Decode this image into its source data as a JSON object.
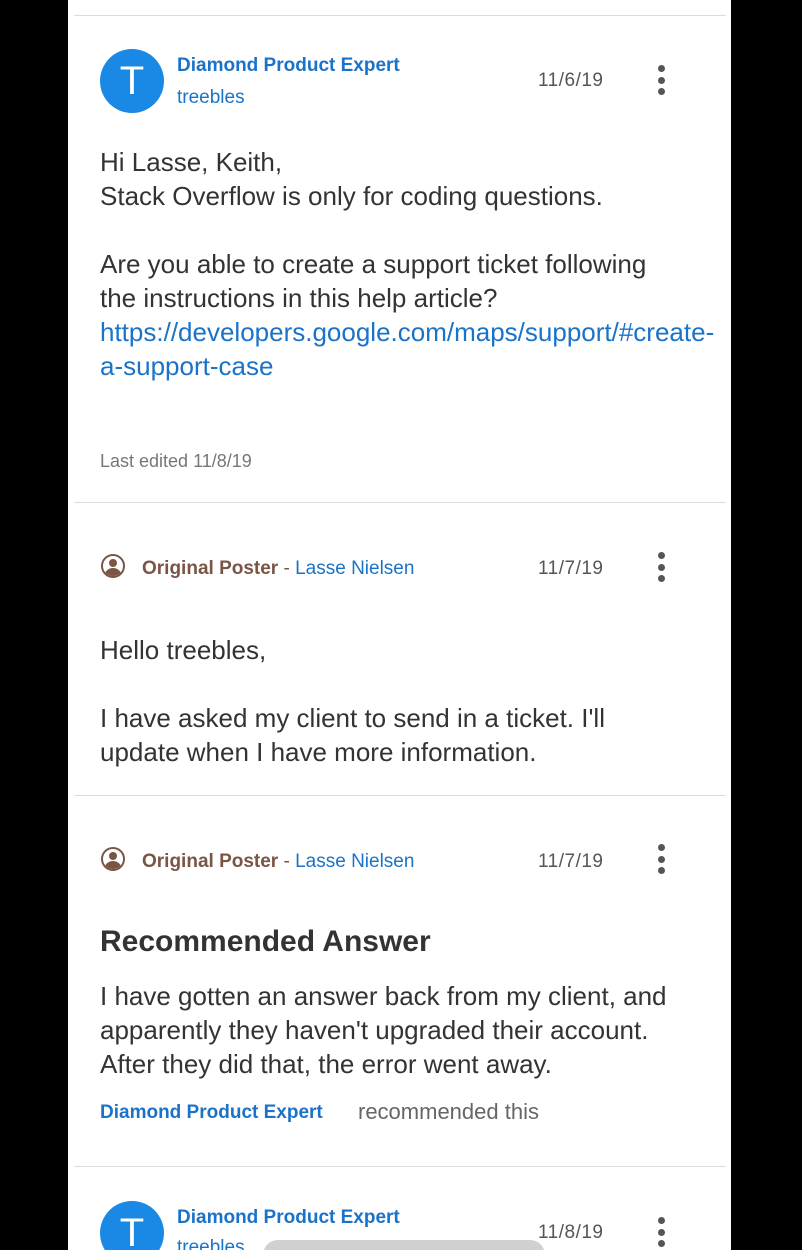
{
  "posts": [
    {
      "avatar_letter": "T",
      "role": "Diamond Product Expert",
      "username": "treebles",
      "date": "11/6/19",
      "lines": [
        "Hi Lasse, Keith,",
        "Stack Overflow is only for coding questions.",
        "",
        "Are you able to create a support ticket following",
        "the instructions in this help article?"
      ],
      "link_lines": [
        "https://developers.google.com/maps/support/#create-",
        "a-support-case"
      ],
      "edited": "Last edited 11/8/19"
    },
    {
      "op_label": "Original Poster",
      "separator": " - ",
      "username": "Lasse Nielsen",
      "date": "11/7/19",
      "lines": [
        "Hello treebles,",
        "",
        "I have asked my client to send in a ticket. I'll",
        "update when I have more information."
      ]
    },
    {
      "op_label": "Original Poster",
      "separator": " - ",
      "username": "Lasse Nielsen",
      "date": "11/7/19",
      "heading": "Recommended Answer",
      "lines": [
        "I have gotten an answer back from my client, and",
        "apparently they haven't upgraded their account.",
        "After they did that, the error went away."
      ],
      "recommended_by": "Diamond Product Expert",
      "recommended_text": "recommended this"
    },
    {
      "avatar_letter": "T",
      "role": "Diamond Product Expert",
      "username": "treebles",
      "date": "11/8/19"
    }
  ],
  "colors": {
    "accent": "#1a73c9",
    "avatar": "#1a88e5",
    "op": "#7a5545",
    "text": "#333333"
  }
}
